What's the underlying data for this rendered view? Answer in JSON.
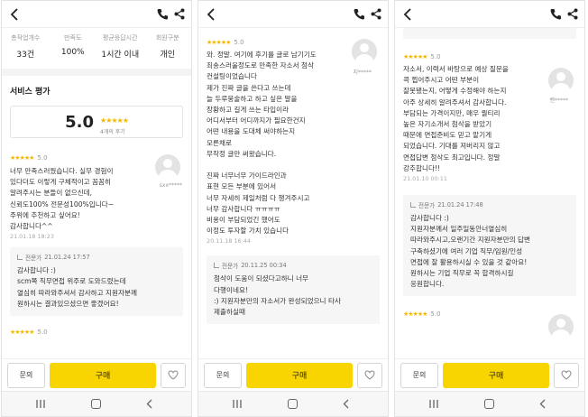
{
  "panel1": {
    "stats": {
      "labels": [
        "총작업개수",
        "만족도",
        "평균응답시간",
        "회원구분"
      ],
      "values": [
        "33건",
        "100%",
        "1시간 이내",
        "개인"
      ]
    },
    "service_title": "서비스 평가",
    "score": "5.0",
    "score_stars": "★★★★★",
    "score_count": "4개의 후기",
    "review": {
      "stars": "★★★★★",
      "rating": "5.0",
      "user": "sxx*****",
      "text": "너무 만족스러웠습니다. 실무 경험이\n있다더도 이렇게 구체적이고 꼼꼼히\n알려주시는 분들이 없으신데,\n신뢰도100% 전문성100%입니다~\n주위에 추천하고 싶어요!\n감사합니다^^",
      "date": "21.01.18 18:23"
    },
    "reply": {
      "label": "전문가",
      "date": "21.01.24 17:57",
      "text": "감사합니다 :)\nscm쪽 직무면접 위주로 도와드렸는데\n열심히 따라와주셔서 감사하고 지원자분께\n원하시는 결과있으셨으면 좋겠어요!"
    },
    "next_stars": "★★★★★",
    "next_rating": "5.0"
  },
  "panel2": {
    "review_top": {
      "stars": "★★★★★",
      "rating": "5.0",
      "user": "지*****",
      "text": "와. 정말. 여기에 후기를 글로 남기기도\n죄송스러울정도로 만족한 자소서 첨삭\n컨설팅이었습니다\n제가 진짜 글을 쓴다고 쓰는데\n늘 두루뭉술하고 하고 싶은 말을\n장황하고 길게 쓰는 타입이라\n어디서부터 어디까지가 필요한건지\n어떤 내용을 도대체 써야하는지\n모른채로\n무작정 글만 써왔습니다.\n\n진짜 너무너무 가이드라인과\n표현 모든 부분에 있어서\n너무 자세히 제일처럼 다 챙겨주시고\n너무 감사합니다 ㅠㅠㅠㅠ\n비용이 부담되었긴 했어도\n이정도 투자할 가치 있습니다",
      "date": "20.11.18 16:44"
    },
    "reply": {
      "label": "전문가",
      "date": "20.11.25 00:34",
      "text": "첨삭이 도움이 되셨다고하니 너무\n다행이네요!\n:) 지원자분만의 자소서가 완성되었으니 타사\n제출하실때"
    }
  },
  "panel3": {
    "review": {
      "stars": "★★★★★",
      "rating": "5.0",
      "user": "밴*****",
      "text": "자소서, 이력서 바탕으로 예상 질문을\n콕 찝어주시고 어떤 부분이\n잘못됐는지, 어떻게 수정해야 하는지\n아주 상세히 알려주셔서 감사합니다.\n부담되는 가격이지만, 매우 퀄티리\n높은 자기소개서 첨삭을 받았기\n때문에 면접준비도 믿고 맡기게\n되었습니다.  기대를 져버리지 않고\n면접답변 첨삭도  최고입니다. 정말\n강추합니다!!",
      "date": "21.01.10 00:11"
    },
    "reply": {
      "label": "전문가",
      "date": "21.01.24 17:48",
      "text": "감사합니다 :)\n지원자분께서 일주일동안너열심히\n따라와주시고,오랜기간 지원자분만의 답변\n구축하셨기에 여러 기업 직무/임원/인성\n면접에 잘 활용하시실 수 있을 것 같아요!\n원하시는 기업 직무로 꼭 합격하시길\n응원합니다."
    },
    "next_stars": "★★★★★",
    "next_rating": "5.0"
  },
  "bottom": {
    "inquiry_label": "문의",
    "buy_label": "구매"
  },
  "colors": {
    "accent_yellow": "#f8d400",
    "star": "#f5b800"
  },
  "icons": [
    "back-arrow-icon",
    "phone-icon",
    "share-icon",
    "heart-icon",
    "recent-apps-icon",
    "home-icon",
    "nav-back-icon",
    "avatar-icon",
    "reply-arrow-icon"
  ]
}
